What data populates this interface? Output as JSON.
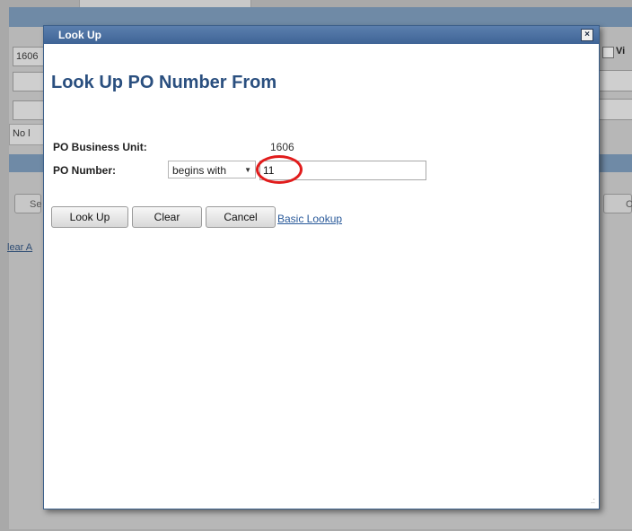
{
  "background": {
    "field_1": "1606",
    "row_label": "No l",
    "clear_link": "lear A",
    "button_partial_left": "Se",
    "checkbox_text": "Vi",
    "button_partial_right": "C"
  },
  "modal": {
    "title": "Look Up",
    "close_symbol": "×",
    "heading": "Look Up PO Number From",
    "fields": {
      "business_unit_label": "PO Business Unit:",
      "business_unit_value": "1606",
      "po_number_label": "PO Number:",
      "operator": "begins with",
      "po_number_value": "11"
    },
    "buttons": {
      "lookup": "Look Up",
      "clear": "Clear",
      "cancel": "Cancel",
      "basic_lookup": "Basic Lookup"
    },
    "resize_glyph": ".:"
  },
  "colors": {
    "accent": "#2a4f7f",
    "title_bar": "#3f6496",
    "highlight": "#e11c1c"
  },
  "icons": {
    "close": "close-icon",
    "dropdown": "chevron-down-icon"
  }
}
